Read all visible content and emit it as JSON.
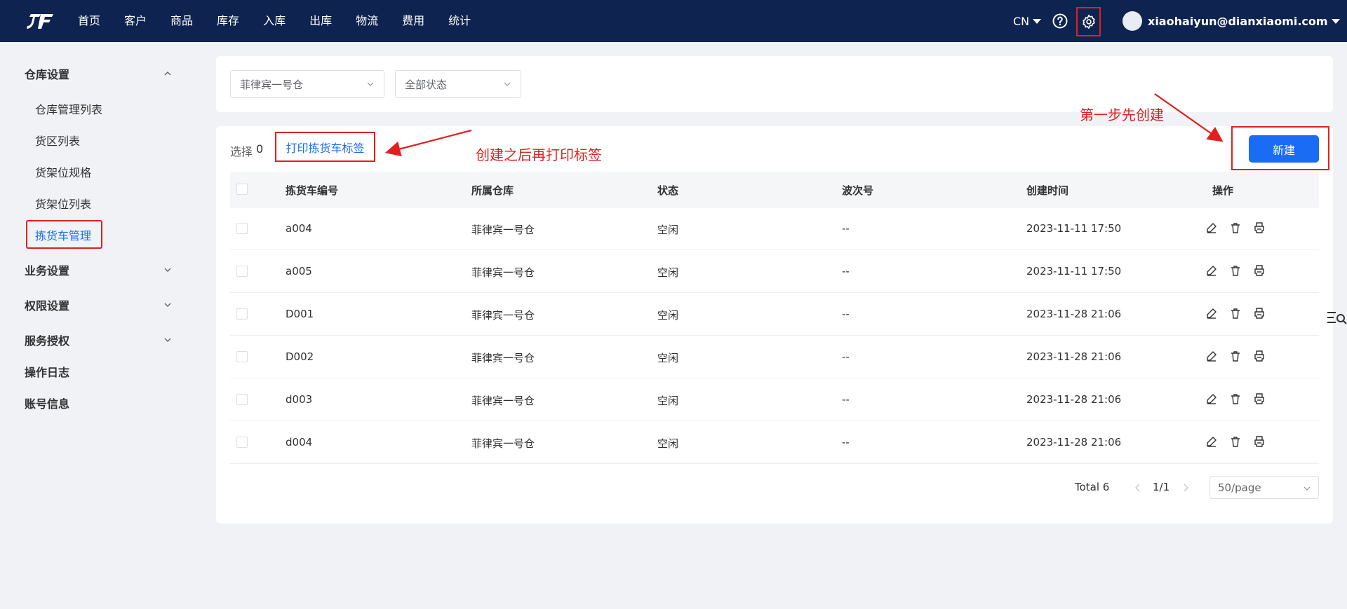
{
  "nav": {
    "items": [
      "首页",
      "客户",
      "商品",
      "库存",
      "入库",
      "出库",
      "物流",
      "费用",
      "统计"
    ],
    "lang": "CN",
    "user_email": "xiaohaiyun@dianxiaomi.com"
  },
  "sidebar": {
    "group1": "仓库设置",
    "items": [
      "仓库管理列表",
      "货区列表",
      "货架位规格",
      "货架位列表",
      "拣货车管理"
    ],
    "group2": "业务设置",
    "group3": "权限设置",
    "group4": "服务授权",
    "group5": "操作日志",
    "group6": "账号信息"
  },
  "filters": {
    "warehouse": "菲律宾一号仓",
    "status": "全部状态"
  },
  "toolbar": {
    "selected_label": "选择",
    "selected_count": "0",
    "print_label": "打印拣货车标签",
    "new_label": "新建"
  },
  "annotations": {
    "print_note": "创建之后再打印标签",
    "create_note": "第一步先创建"
  },
  "table": {
    "headers": [
      "拣货车编号",
      "所属仓库",
      "状态",
      "波次号",
      "创建时间",
      "操作"
    ],
    "rows": [
      [
        "a004",
        "菲律宾一号仓",
        "空闲",
        "--",
        "2023-11-11 17:50"
      ],
      [
        "a005",
        "菲律宾一号仓",
        "空闲",
        "--",
        "2023-11-11 17:50"
      ],
      [
        "D001",
        "菲律宾一号仓",
        "空闲",
        "--",
        "2023-11-28 21:06"
      ],
      [
        "D002",
        "菲律宾一号仓",
        "空闲",
        "--",
        "2023-11-28 21:06"
      ],
      [
        "d003",
        "菲律宾一号仓",
        "空闲",
        "--",
        "2023-11-28 21:06"
      ],
      [
        "d004",
        "菲律宾一号仓",
        "空闲",
        "--",
        "2023-11-28 21:06"
      ]
    ],
    "row_actions": [
      "edit-icon",
      "trash-icon",
      "printer-icon"
    ]
  },
  "pagination": {
    "total": "Total 6",
    "page": "1/1",
    "page_size": "50/page"
  },
  "colors": {
    "topbar": "#0e2350",
    "primary": "#1a6cf5",
    "annotation": "#e02020"
  }
}
